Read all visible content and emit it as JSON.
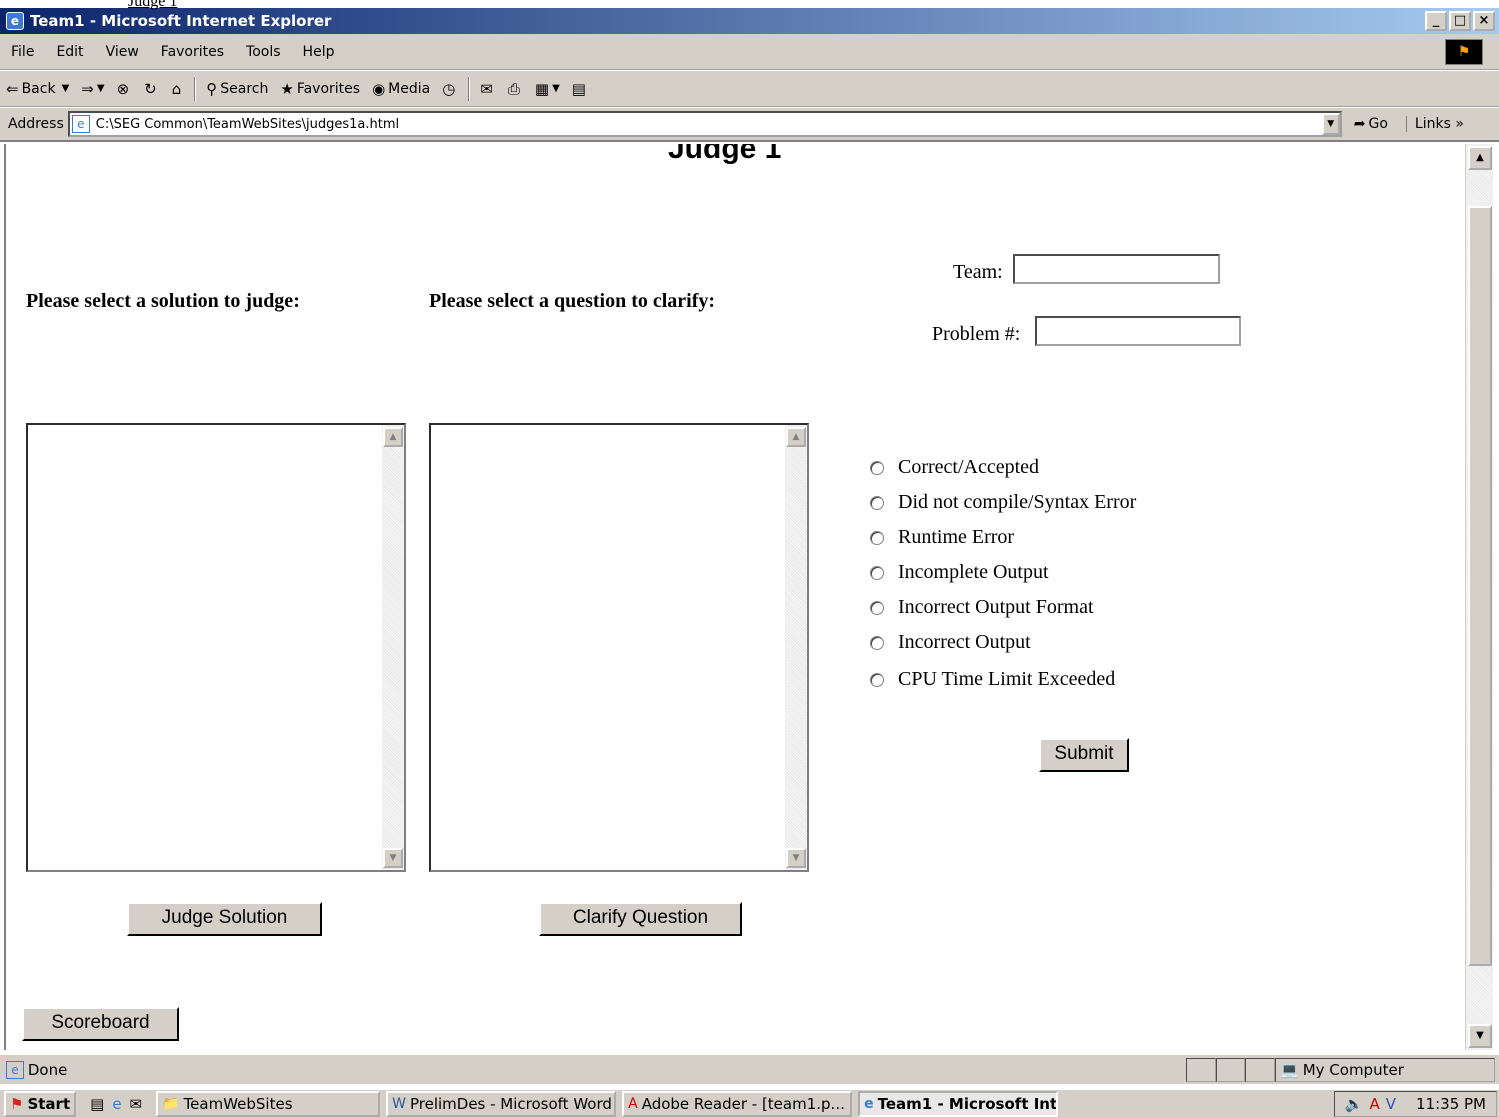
{
  "window": {
    "overlay_text": "Judge 1",
    "title": "Team1 - Microsoft Internet Explorer",
    "min_label": "_",
    "max_label": "□",
    "close_label": "×"
  },
  "menu": [
    "File",
    "Edit",
    "View",
    "Favorites",
    "Tools",
    "Help"
  ],
  "toolbar": {
    "back": "Back",
    "search": "Search",
    "favorites": "Favorites",
    "media": "Media"
  },
  "address": {
    "label": "Address",
    "value": "C:\\SEG Common\\TeamWebSites\\judges1a.html",
    "go": "Go",
    "links": "Links"
  },
  "page": {
    "title": "Judge 1",
    "solution_header": "Please select a solution to judge:",
    "question_header": "Please select a question to clarify:",
    "team_label": "Team:",
    "team_value": "",
    "problem_label": "Problem #:",
    "problem_value": "",
    "verdicts": [
      "Correct/Accepted",
      "Did not compile/Syntax Error",
      "Runtime Error",
      "Incomplete Output",
      "Incorrect Output Format",
      "Incorrect Output",
      "CPU Time Limit Exceeded"
    ],
    "submit": "Submit",
    "judge_solution": "Judge Solution",
    "clarify_question": "Clarify Question",
    "scoreboard": "Scoreboard"
  },
  "status": {
    "text": "Done",
    "zone": "My Computer"
  },
  "taskbar": {
    "start": "Start",
    "tasks": [
      "TeamWebSites",
      "PrelimDes - Microsoft Word",
      "Adobe Reader - [team1.p...",
      "Team1 - Microsoft Int..."
    ],
    "clock": "11:35 PM"
  }
}
